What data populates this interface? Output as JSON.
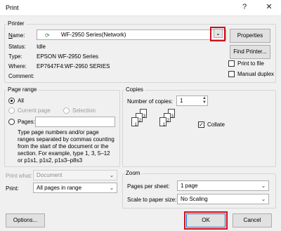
{
  "window": {
    "title": "Print",
    "help_glyph": "?",
    "close_glyph": "✕"
  },
  "printer": {
    "group_label": "Printer",
    "name_label": "Name:",
    "name_value": "WF-2950 Series(Network)",
    "status_label": "Status:",
    "status_value": "Idle",
    "type_label": "Type:",
    "type_value": "EPSON WF-2950 Series",
    "where_label": "Where:",
    "where_value": "EP7647F4:WF-2950 SERIES",
    "comment_label": "Comment:",
    "comment_value": "",
    "properties_button": "Properties",
    "find_printer_button": "Find Printer...",
    "print_to_file": "Print to file",
    "manual_duplex": "Manual duplex"
  },
  "page_range": {
    "group_label": "Page range",
    "all": "All",
    "current_page": "Current page",
    "selection": "Selection",
    "pages": "Pages:",
    "pages_value": "",
    "help_text": "Type page numbers and/or page ranges separated by commas counting from the start of the document or the section. For example, type 1, 3, 5–12 or p1s1, p1s2, p1s3–p8s3"
  },
  "copies": {
    "group_label": "Copies",
    "number_label": "Number of copies:",
    "number_value": "1",
    "collate": "Collate"
  },
  "print_what": {
    "label": "Print what:",
    "value": "Document"
  },
  "print": {
    "label": "Print:",
    "value": "All pages in range"
  },
  "zoom": {
    "group_label": "Zoom",
    "pages_per_sheet_label": "Pages per sheet:",
    "pages_per_sheet_value": "1 page",
    "scale_label": "Scale to paper size:",
    "scale_value": "No Scaling"
  },
  "buttons": {
    "options": "Options...",
    "ok": "OK",
    "cancel": "Cancel"
  },
  "icons": {
    "printer": "network-printer-icon",
    "dropdown": "chevron-down-icon",
    "spinner": "spinner-arrows-icon"
  },
  "colors": {
    "highlight": "#d0101a",
    "dialog_bg": "#f0f0f0"
  }
}
